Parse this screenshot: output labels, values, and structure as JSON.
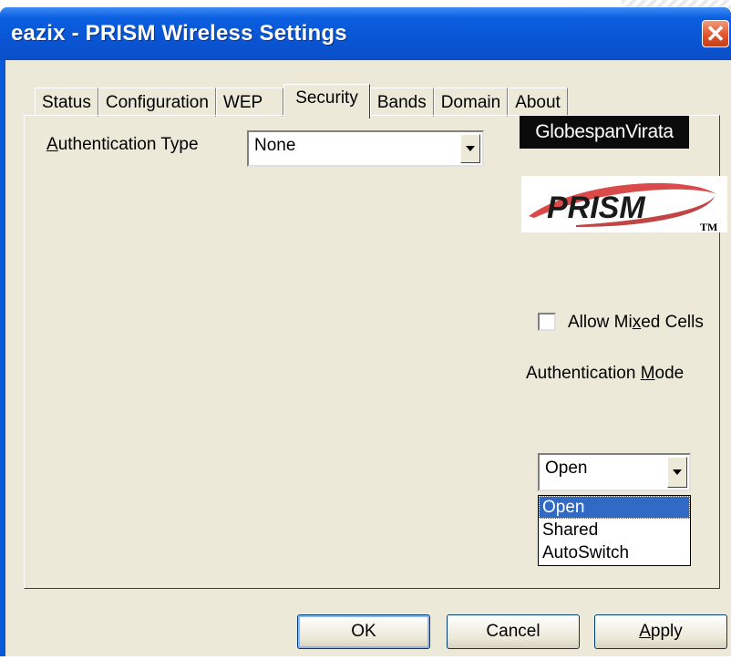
{
  "window": {
    "title": "eazix - PRISM Wireless Settings",
    "close_glyph": "✕"
  },
  "tabs": [
    {
      "label": "Status"
    },
    {
      "label": "Configuration"
    },
    {
      "label": "WEP"
    },
    {
      "label": "Security"
    },
    {
      "label": "Bands"
    },
    {
      "label": "Domain"
    },
    {
      "label": "About"
    }
  ],
  "active_tab": "Security",
  "security": {
    "auth_type_label_pre": "",
    "auth_type_label_ul": "A",
    "auth_type_label_post": "uthentication Type",
    "auth_type_value": "None",
    "logo_globespan": "GlobespanVirata",
    "logo_prism": "PRISM",
    "logo_tm": "TM",
    "mixed_cells_label_pre": "Allow Mi",
    "mixed_cells_label_ul": "x",
    "mixed_cells_label_post": "ed Cells",
    "mixed_cells_checked": false,
    "auth_mode_label_pre": "Authentication ",
    "auth_mode_label_ul": "M",
    "auth_mode_label_post": "ode",
    "auth_mode_value": "Open",
    "auth_mode_options": [
      "Open",
      "Shared",
      "AutoSwitch"
    ],
    "auth_mode_selected_index": 0
  },
  "buttons": {
    "ok": "OK",
    "cancel": "Cancel",
    "apply_ul": "A",
    "apply_rest": "pply"
  },
  "colors": {
    "titlebar": "#0a55d4",
    "dialog_bg": "#ece9d8",
    "selection": "#316ac5",
    "close": "#e0552c",
    "prism_red": "#d42a2a"
  }
}
